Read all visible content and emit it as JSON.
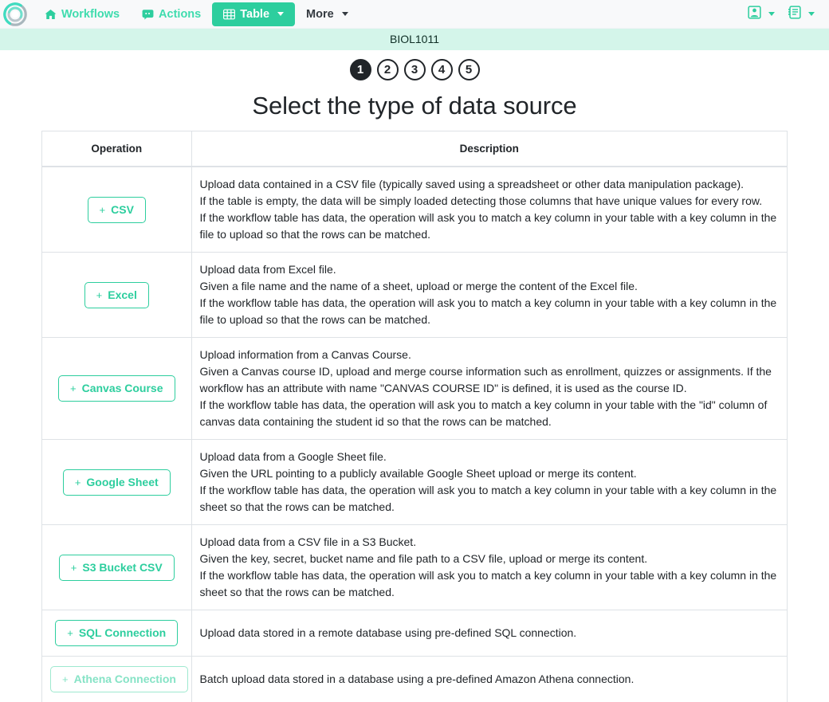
{
  "navbar": {
    "logo_icon": "ontask-ring-logo",
    "items": [
      {
        "label": "Workflows",
        "icon": "home-icon",
        "active": false
      },
      {
        "label": "Actions",
        "icon": "comment-icon",
        "active": false
      },
      {
        "label": "Table",
        "icon": "table-grid-icon",
        "active": true,
        "has_caret": true
      },
      {
        "label": "More",
        "icon": "",
        "active": false,
        "has_caret": true
      }
    ],
    "right_items": [
      {
        "icon": "user-card-icon",
        "has_caret": true
      },
      {
        "icon": "notes-list-icon",
        "has_caret": true
      }
    ]
  },
  "course_banner": {
    "title": "BIOL1011"
  },
  "steps": {
    "items": [
      "1",
      "2",
      "3",
      "4",
      "5"
    ],
    "current": "1"
  },
  "page_title": "Select the type of data source",
  "table": {
    "headers": {
      "operation": "Operation",
      "description": "Description"
    },
    "rows": [
      {
        "button_label": "CSV",
        "plus": "+",
        "disabled": false,
        "description": [
          "Upload data contained in a CSV file (typically saved using a spreadsheet or other data manipulation package).",
          "If the table is empty, the data will be simply loaded detecting those columns that have unique values for every row.",
          "If the workflow table has data, the operation will ask you to match a key column in your table with a key column in the file to upload so that the rows can be matched."
        ]
      },
      {
        "button_label": "Excel",
        "plus": "+",
        "disabled": false,
        "description": [
          "Upload data from Excel file.",
          "Given a file name and the name of a sheet, upload or merge the content of the Excel file.",
          "If the workflow table has data, the operation will ask you to match a key column in your table with a key column in the file to upload so that the rows can be matched."
        ]
      },
      {
        "button_label": "Canvas Course",
        "plus": "+",
        "disabled": false,
        "description": [
          "Upload information from a Canvas Course.",
          "Given a Canvas course ID, upload and merge course information such as enrollment, quizzes or assignments. If the workflow has an attribute with name \"CANVAS COURSE ID\" is defined, it is used as the course ID.",
          "If the workflow table has data, the operation will ask you to match a key column in your table with the \"id\" column of canvas data containing the student id so that the rows can be matched."
        ]
      },
      {
        "button_label": "Google Sheet",
        "plus": "+",
        "disabled": false,
        "description": [
          "Upload data from a Google Sheet file.",
          "Given the URL pointing to a publicly available Google Sheet upload or merge its content.",
          "If the workflow table has data, the operation will ask you to match a key column in your table with a key column in the sheet so that the rows can be matched."
        ]
      },
      {
        "button_label": "S3 Bucket CSV",
        "plus": "+",
        "disabled": false,
        "description": [
          "Upload data from a CSV file in a S3 Bucket.",
          "Given the key, secret, bucket name and file path to a CSV file, upload or merge its content.",
          "If the workflow table has data, the operation will ask you to match a key column in your table with a key column in the sheet so that the rows can be matched."
        ]
      },
      {
        "button_label": "SQL Connection",
        "plus": "+",
        "disabled": false,
        "description": [
          "Upload data stored in a remote database using pre-defined SQL connection."
        ]
      },
      {
        "button_label": "Athena Connection",
        "plus": "+",
        "disabled": true,
        "description": [
          "Batch upload data stored in a database using a pre-defined Amazon Athena connection."
        ]
      }
    ]
  },
  "colors": {
    "accent": "#2dce9e",
    "banner_bg": "#d4f5ea",
    "navbar_bg": "#f8f9fa",
    "border": "#dee2e6",
    "text": "#212529",
    "muted_accent": "#86e3c6"
  }
}
